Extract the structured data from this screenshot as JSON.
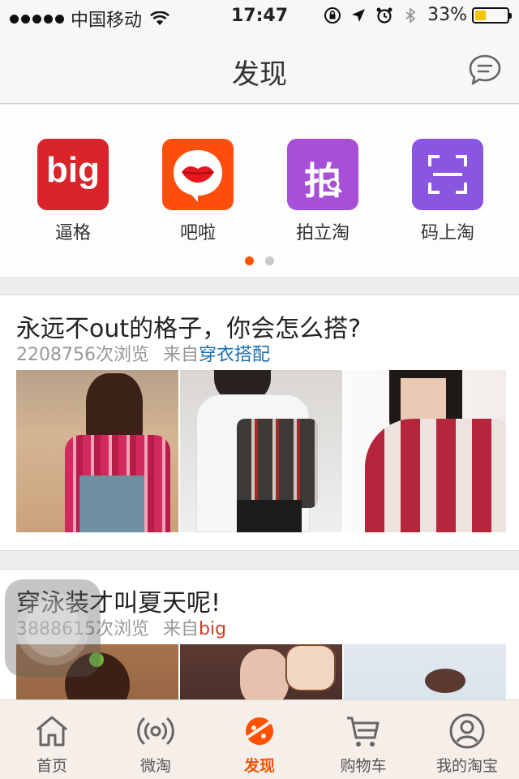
{
  "status_bar": {
    "carrier": "中国移动",
    "time": "17:47",
    "battery": "33%",
    "battery_level": 0.33,
    "battery_color": "#f5c400"
  },
  "nav": {
    "title": "发现",
    "chat_icon": "chat-bubble-icon"
  },
  "apps": [
    {
      "label": "逼格",
      "tile_text": "big",
      "color": "#d8242a",
      "icon": "big-logo-icon"
    },
    {
      "label": "吧啦",
      "tile_text": "",
      "color": "#ff4e0d",
      "icon": "lips-speech-icon"
    },
    {
      "label": "拍立淘",
      "tile_text": "拍",
      "color": "#a74fd6",
      "icon": "photo-search-icon"
    },
    {
      "label": "码上淘",
      "tile_text": "",
      "color": "#8a55e0",
      "icon": "scan-frame-icon"
    }
  ],
  "page_dots": {
    "count": 2,
    "active_index": 0,
    "active_color": "#ff5000",
    "inactive_color": "#c8c8c8"
  },
  "cards": [
    {
      "title": "永远不out的格子，你会怎么搭?",
      "views": "2208756次浏览",
      "from_label": "来自",
      "source": "穿衣搭配",
      "source_color": "#1b6fb4"
    },
    {
      "title": "穿泳装才叫夏天呢!",
      "views": "3888615次浏览",
      "from_label": "来自",
      "source": "big",
      "source_color": "#d23a2a"
    }
  ],
  "tabs": [
    {
      "label": "首页",
      "icon": "home-icon",
      "active": false
    },
    {
      "label": "微淘",
      "icon": "broadcast-icon",
      "active": false
    },
    {
      "label": "发现",
      "icon": "discover-planet-icon",
      "active": true
    },
    {
      "label": "购物车",
      "icon": "cart-icon",
      "active": false
    },
    {
      "label": "我的淘宝",
      "icon": "profile-icon",
      "active": false
    }
  ],
  "accent_color": "#ff5000"
}
